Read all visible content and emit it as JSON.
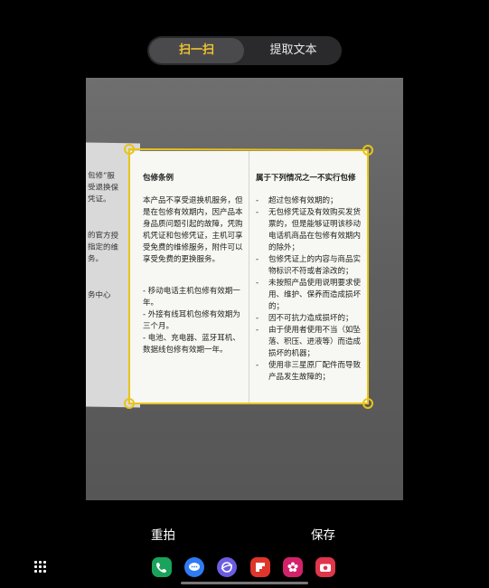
{
  "mode_switch": {
    "scan_label": "扫一扫",
    "extract_label": "提取文本"
  },
  "background_doc": {
    "lines": [
      "包修”服",
      "受退换保",
      "凭证。",
      "的官方授",
      "指定的维",
      "务。",
      "务中心"
    ]
  },
  "document": {
    "left_title": "包修条例",
    "left_paragraph": "本产品不享受退换机服务，但是在包修有效期内，因产品本身品质问题引起的故障，凭购机凭证和包修凭证，主机可享受免费的维修服务，附件可以享受免费的更换服务。",
    "left_list": [
      "- 移动电话主机包修有效期一年。",
      "- 外接有线耳机包修有效期为三个月。",
      "- 电池、充电器、蓝牙耳机、数据线包修有效期一年。"
    ],
    "right_title": "属于下列情况之一不实行包修",
    "right_list": [
      "超过包修有效期的；",
      "无包修凭证及有效购买发货票的，但是能够证明该移动电话机商品在包修有效期内的除外；",
      "包修凭证上的内容与商品实物标识不符或者涂改的；",
      "未按照产品使用说明要求使用、维护、保养而造成损坏的；",
      "因不可抗力造成损坏的；",
      "由于使用者使用不当（如坠落、积压、进液等）而造成损坏的机器；",
      "使用非三星原厂配件而导致产品发生故障的；"
    ]
  },
  "bottom_bar": {
    "retake_label": "重拍",
    "save_label": "保存"
  },
  "dock": {
    "apps": [
      {
        "name": "phone-icon",
        "color": "#19a35b"
      },
      {
        "name": "messages-icon",
        "color": "#2f7bf5"
      },
      {
        "name": "internet-icon",
        "color": "#6b5ce0"
      },
      {
        "name": "flipboard-icon",
        "color": "#e0352b"
      },
      {
        "name": "gallery-icon",
        "color": "#d2226a"
      },
      {
        "name": "camera-icon",
        "color": "#e0354a"
      }
    ]
  },
  "colors": {
    "accent": "#f2c230",
    "selection": "#e8c419"
  }
}
